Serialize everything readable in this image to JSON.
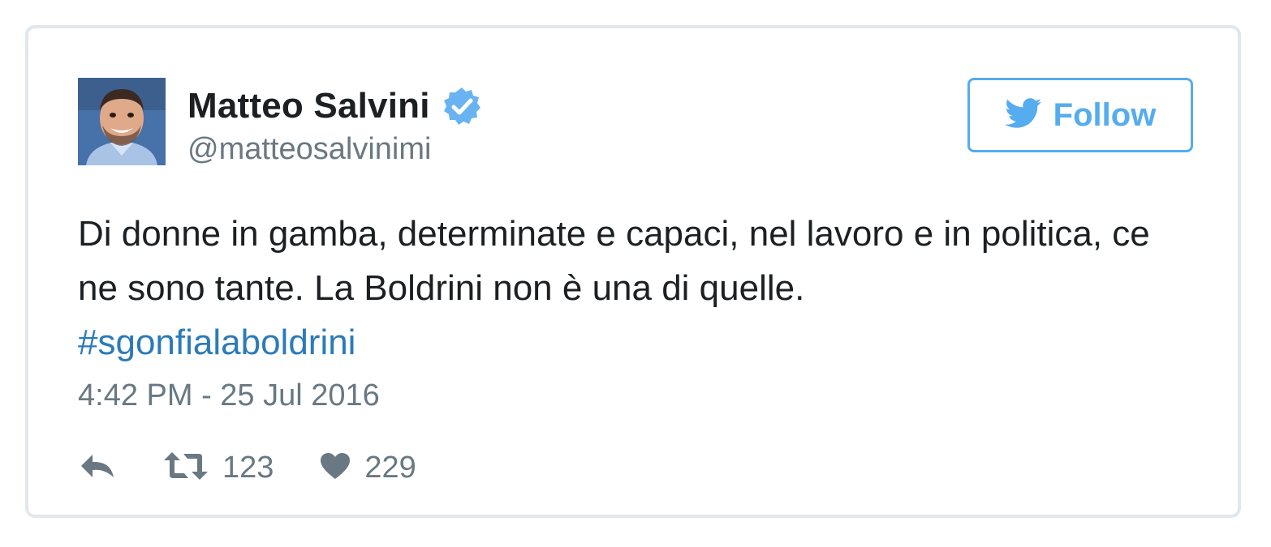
{
  "author": {
    "name": "Matteo Salvini",
    "handle": "@matteosalvinimi",
    "verified": true
  },
  "follow_button": {
    "label": "Follow",
    "icon": "twitter-bird-icon"
  },
  "tweet": {
    "text": "Di donne in gamba, determinate e capaci, nel lavoro e in politica, ce ne sono tante. La Boldrini non è una di quelle.",
    "hashtag": "#sgonfialaboldrini",
    "timestamp": "4:42 PM - 25 Jul 2016"
  },
  "actions": {
    "reply": {
      "icon": "reply-icon"
    },
    "retweet": {
      "icon": "retweet-icon",
      "count": "123"
    },
    "like": {
      "icon": "heart-icon",
      "count": "229"
    }
  },
  "colors": {
    "accent": "#55acee",
    "link": "#2b7bb9",
    "text": "#1c2022",
    "muted": "#697882",
    "border": "#e1e8ed",
    "verified": "#6ab3f3"
  }
}
